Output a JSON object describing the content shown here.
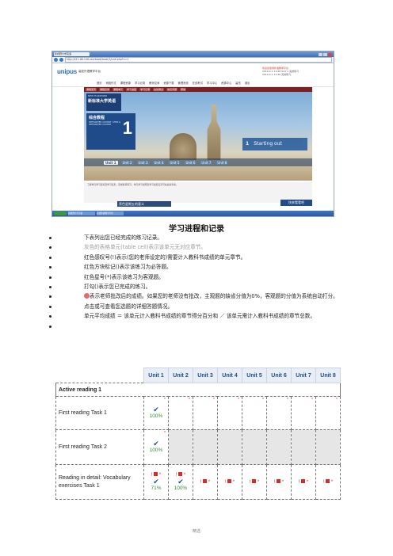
{
  "screenshot": {
    "tab_title": "新视野大学英语",
    "url": "http://211.86.108.xxx/book/book/2/unit.php?u=1",
    "site_name": "unipus",
    "site_sub": "高校外语教学平台",
    "user_lines": [
      "欢迎您使用外语教学平台",
      "2014-2-1 11:00 Unit 1 完成练习",
      "2014-2-1 11:20 完成练习"
    ],
    "nav_items": [
      "首页",
      "网络作文",
      "课程资源",
      "学习记录",
      "教师空间",
      "资源下载",
      "管理系统",
      "在线考试",
      "学习中心",
      "资源中心",
      "留言",
      "退出"
    ],
    "menu_items": [
      "课程首页",
      "课程目录",
      "课程单元",
      "学习进度",
      "学习记录",
      "在线测试",
      "常见问题",
      "帮助"
    ],
    "book_series": "NEW HORIZONS",
    "book_name": "新标准大学英语",
    "panel_title": "综合教程",
    "panel_sub": "INTEGRATED COURSE / VIEW & INTEGRATED COURSE",
    "panel_number": "1",
    "start_number": "1",
    "start_text": "Starting out",
    "units": [
      "Unit 1",
      "Unit 2",
      "Unit 3",
      "Unit 4",
      "Unit 5",
      "Unit 6",
      "Unit 7",
      "Unit 8"
    ],
    "notes_text": "了解单元学习目标及学习任务，完成各项练习。单元学习说明及学习进度记录可在此处查看。",
    "banner_text": "黑色星期五的意义",
    "banner2_text": "快来看看吧"
  },
  "doc": {
    "title": "学习进程和记录",
    "bullets": [
      "下表列出您已经完成的练习记录。",
      "灰色的表格单元(table cell)表示该单元无对应章节。",
      "红色感叹号(!)表示(您的老师设定的)需要计入教科书成绩的单元章节。",
      "红色方块标记()表示该练习为必答题。",
      "红色星号(*)表示该练习为客观题。",
      "打勾()表示您已完成的练习。",
      "表示老师批改后的成绩。如果您的老师没有批改，主观题的缺省分值为0%，客观题的分值为系统自动打分。",
      "点击或可查看您选题的详细答题情况。",
      "单元平均成绩 ＝ 该单元计入教科书成绩的章节得分百分和 ／ 该单元需计入教科书成绩的章节总数。"
    ]
  },
  "table": {
    "units": [
      "Unit 1",
      "Unit 2",
      "Unit 3",
      "Unit 4",
      "Unit 5",
      "Unit 6",
      "Unit 7",
      "Unit 8"
    ],
    "section": "Active reading 1",
    "rows": [
      {
        "task": "First reading Task 1",
        "unit1_pct": "100%"
      },
      {
        "task": "First reading Task 2",
        "unit1_pct": "100%"
      },
      {
        "task": "Reading in detail: Vocabulary exercises Task 1",
        "unit1_pct": "71%",
        "unit2_pct": "100%"
      }
    ]
  },
  "footer": "精选"
}
